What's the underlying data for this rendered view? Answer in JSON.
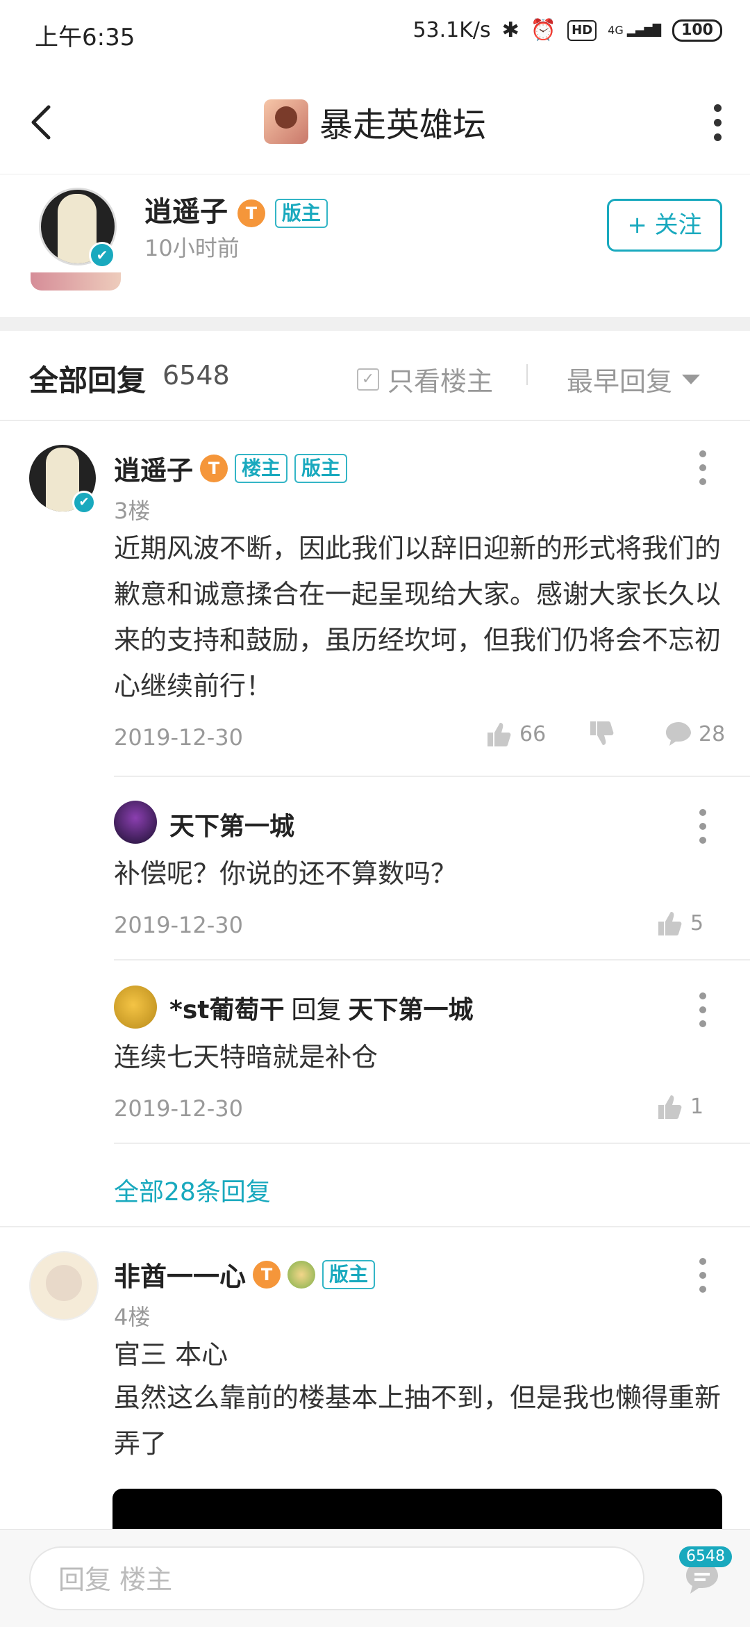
{
  "status_bar": {
    "time": "上午6:35",
    "speed": "53.1K/s",
    "hd": "HD",
    "network": "4G",
    "battery": "100"
  },
  "nav": {
    "back_icon": "chevron-left-icon",
    "forum_title": "暴走英雄坛",
    "more_icon": "more-vertical-icon"
  },
  "author": {
    "name": "逍遥子",
    "level": "T",
    "tag": "版主",
    "time": "10小时前",
    "follow_label": "+ 关注"
  },
  "replies_header": {
    "label": "全部回复",
    "count": "6548",
    "only_owner": "只看楼主",
    "order": "最早回复"
  },
  "posts": [
    {
      "name": "逍遥子",
      "level": "T",
      "tags": [
        "楼主",
        "版主"
      ],
      "floor": "3楼",
      "text": "近期风波不断，因此我们以辞旧迎新的形式将我们的歉意和诚意揉合在一起呈现给大家。感谢大家长久以来的支持和鼓励，虽历经坎坷，但我们仍将会不忘初心继续前行！",
      "date": "2019-12-30",
      "likes": "66",
      "comments": "28",
      "sub_replies": [
        {
          "name": "天下第一城",
          "text": "补偿呢？你说的还不算数吗？",
          "date": "2019-12-30",
          "likes": "5"
        },
        {
          "name": "*st葡萄干",
          "reply_word": "回复",
          "reply_to": "天下第一城",
          "text": "连续七天特暗就是补仓",
          "date": "2019-12-30",
          "likes": "1"
        }
      ],
      "view_all": "全部28条回复"
    },
    {
      "name": "非酋一一心",
      "level": "T",
      "tags": [
        "版主"
      ],
      "floor": "4楼",
      "line1": "官三 本心",
      "text": "虽然这么靠前的楼基本上抽不到，但是我也懒得重新弄了"
    }
  ],
  "bottom": {
    "placeholder": "回复  楼主",
    "badge": "6548"
  },
  "colors": {
    "accent": "#19a9be",
    "level_orange": "#f5963a"
  }
}
